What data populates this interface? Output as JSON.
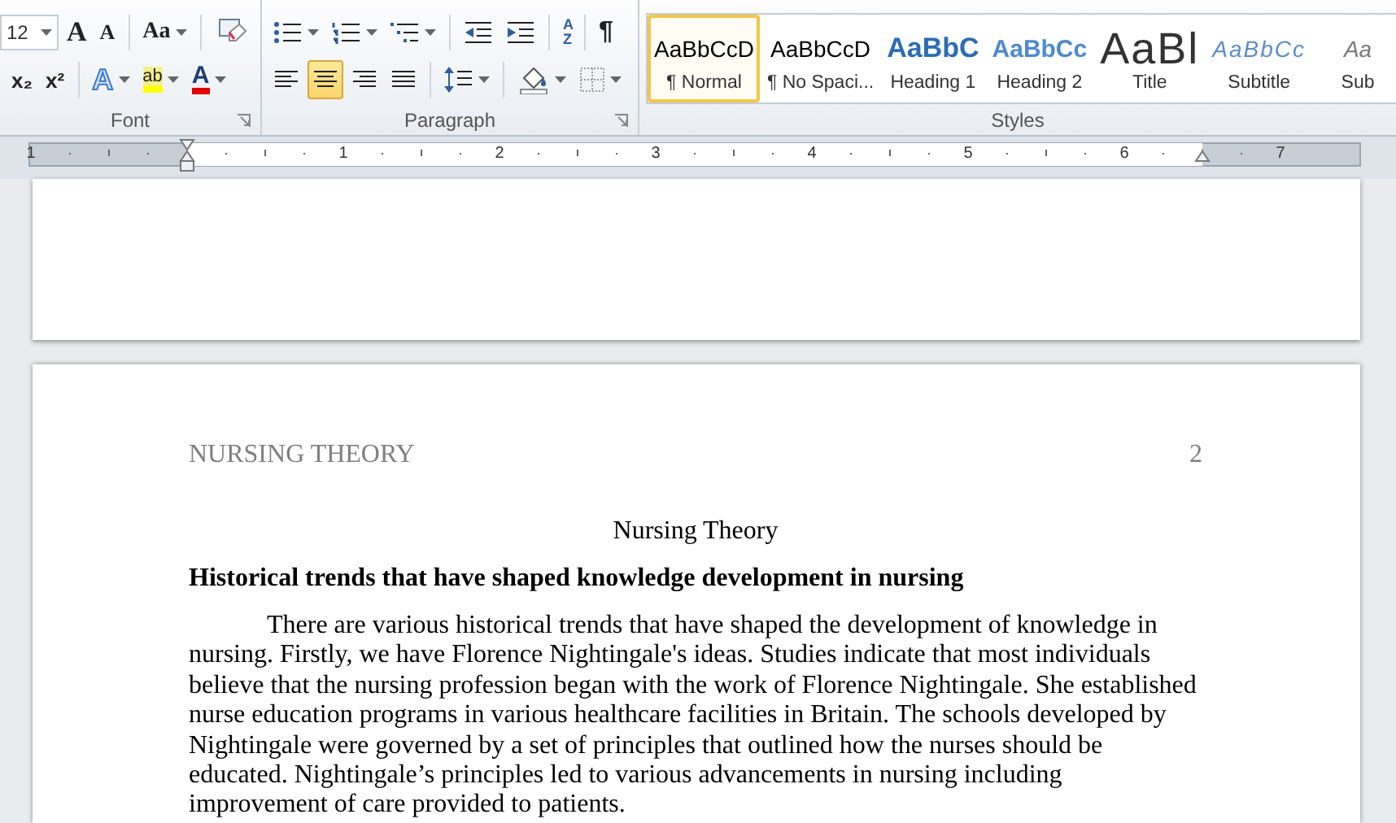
{
  "ribbon": {
    "font_group": {
      "label": "Font",
      "top_row": [
        {
          "kind": "size",
          "text": "12",
          "dropdown": true
        },
        {
          "kind": "grow",
          "text": "A",
          "dropdown": false
        },
        {
          "kind": "shrink",
          "text": "A",
          "dropdown": false
        },
        {
          "kind": "sep"
        },
        {
          "kind": "case",
          "text": "Aa",
          "dropdown": true
        },
        {
          "kind": "sep"
        },
        {
          "kind": "clear",
          "dropdown": false
        }
      ],
      "bottom_row": [
        {
          "kind": "sub",
          "text": "x₂",
          "dropdown": false
        },
        {
          "kind": "sup",
          "text": "x²",
          "dropdown": false
        },
        {
          "kind": "sep"
        },
        {
          "kind": "effects",
          "text": "A",
          "dropdown": true
        },
        {
          "kind": "highlight",
          "text": "ab",
          "dropdown": true
        },
        {
          "kind": "color",
          "text": "A",
          "dropdown": true
        }
      ]
    },
    "paragraph_group": {
      "label": "Paragraph",
      "top_row": [
        {
          "kind": "bullets",
          "dropdown": true
        },
        {
          "kind": "numbering",
          "dropdown": true
        },
        {
          "kind": "multilevel",
          "dropdown": true
        },
        {
          "kind": "sep"
        },
        {
          "kind": "outdent",
          "dropdown": false
        },
        {
          "kind": "indent",
          "dropdown": false
        },
        {
          "kind": "sep"
        },
        {
          "kind": "sort",
          "text": "AZ",
          "dropdown": false
        },
        {
          "kind": "sep"
        },
        {
          "kind": "pilcrow",
          "text": "¶",
          "dropdown": false
        }
      ],
      "bottom_row": [
        {
          "kind": "align-left",
          "dropdown": false,
          "selected": false
        },
        {
          "kind": "align-center",
          "dropdown": false,
          "selected": true
        },
        {
          "kind": "align-right",
          "dropdown": false,
          "selected": false
        },
        {
          "kind": "justify",
          "dropdown": false,
          "selected": false
        },
        {
          "kind": "sep"
        },
        {
          "kind": "spacing",
          "dropdown": true
        },
        {
          "kind": "sep"
        },
        {
          "kind": "shading",
          "dropdown": true
        },
        {
          "kind": "borders",
          "dropdown": true
        }
      ]
    },
    "styles_group": {
      "label": "Styles",
      "styles": [
        {
          "kind": "normal",
          "preview": "AaBbCcD",
          "label": "¶ Normal",
          "selected": true
        },
        {
          "kind": "no-spacing",
          "preview": "AaBbCcD",
          "label": "¶ No Spaci...",
          "selected": false
        },
        {
          "kind": "heading1",
          "preview": "AaBbC",
          "label": "Heading 1",
          "selected": false
        },
        {
          "kind": "heading2",
          "preview": "AaBbCc",
          "label": "Heading 2",
          "selected": false
        },
        {
          "kind": "title",
          "preview": "AaBl",
          "label": "Title",
          "selected": false
        },
        {
          "kind": "subtitle",
          "preview": "AaBbCc",
          "label": "Subtitle",
          "selected": false
        },
        {
          "kind": "subtle",
          "preview": "Aa",
          "label": "Sub",
          "selected": false
        }
      ]
    }
  },
  "ruler": {
    "numbers": [
      "1",
      "1",
      "2",
      "3",
      "4",
      "5",
      "6",
      "7"
    ]
  },
  "document": {
    "header": "NURSING THEORY",
    "page_number": "2",
    "title": "Nursing Theory",
    "heading": "Historical trends that have shaped knowledge development in nursing",
    "paragraph_lines": [
      "There are various historical trends that have shaped the development of knowledge in",
      "nursing. Firstly, we have Florence Nightingale's ideas. Studies indicate that most individuals",
      "believe that the nursing profession began with the work of Florence Nightingale. She established",
      "nurse education programs in various healthcare facilities in Britain. The schools developed by",
      "Nightingale were governed by a set of principles  that outlined how the nurses should be",
      "educated. Nightingale’s principles led to various advancements in nursing including",
      "improvement of care provided to patients."
    ]
  }
}
